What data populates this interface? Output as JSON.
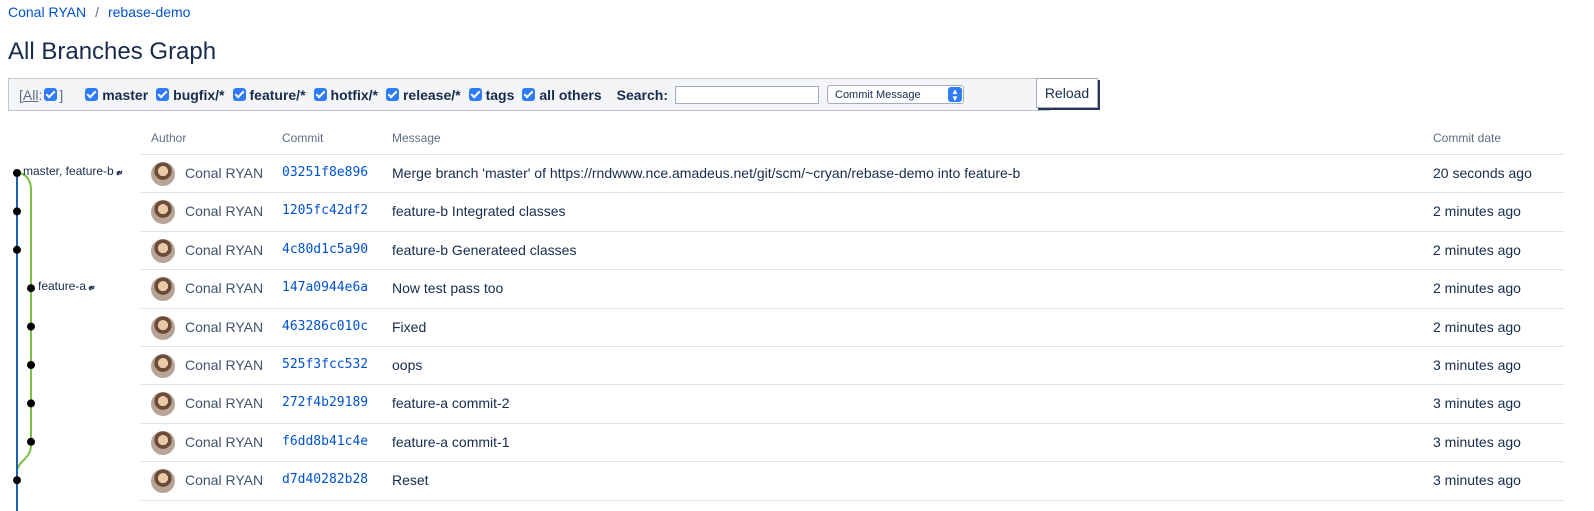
{
  "breadcrumb": {
    "owner": "Conal RYAN",
    "separator": "/",
    "repo": "rebase-demo"
  },
  "page_title": "All Branches Graph",
  "filters": {
    "all_label": "All",
    "all_open": "[",
    "all_colon": ":",
    "all_close": "]",
    "items": [
      {
        "label": "master",
        "checked": true
      },
      {
        "label": "bugfix/*",
        "checked": true
      },
      {
        "label": "feature/*",
        "checked": true
      },
      {
        "label": "hotfix/*",
        "checked": true
      },
      {
        "label": "release/*",
        "checked": true
      },
      {
        "label": "tags",
        "checked": true
      },
      {
        "label": "all others",
        "checked": true
      }
    ],
    "search_label": "Search:",
    "search_value": "",
    "search_type": "Commit Message",
    "reload_label": "Reload"
  },
  "table": {
    "headers": {
      "author": "Author",
      "commit": "Commit",
      "message": "Message",
      "date": "Commit date"
    },
    "rows": [
      {
        "author": "Conal RYAN",
        "commit": "03251f8e896",
        "message": "Merge branch 'master' of https://rndwww.nce.amadeus.net/git/scm/~cryan/rebase-demo into feature-b",
        "date": "20 seconds ago"
      },
      {
        "author": "Conal RYAN",
        "commit": "1205fc42df2",
        "message": "feature-b Integrated classes",
        "date": "2 minutes ago"
      },
      {
        "author": "Conal RYAN",
        "commit": "4c80d1c5a90",
        "message": "feature-b Generateed classes",
        "date": "2 minutes ago"
      },
      {
        "author": "Conal RYAN",
        "commit": "147a0944e6a",
        "message": "Now test pass too",
        "date": "2 minutes ago"
      },
      {
        "author": "Conal RYAN",
        "commit": "463286c010c",
        "message": "Fixed",
        "date": "2 minutes ago"
      },
      {
        "author": "Conal RYAN",
        "commit": "525f3fcc532",
        "message": "oops",
        "date": "3 minutes ago"
      },
      {
        "author": "Conal RYAN",
        "commit": "272f4b29189",
        "message": "feature-a commit-2",
        "date": "3 minutes ago"
      },
      {
        "author": "Conal RYAN",
        "commit": "f6dd8b41c4e",
        "message": "feature-a commit-1",
        "date": "3 minutes ago"
      },
      {
        "author": "Conal RYAN",
        "commit": "d7d40282b28",
        "message": "Reset",
        "date": "3 minutes ago"
      }
    ]
  },
  "graph": {
    "labels": [
      {
        "row": 0,
        "text": "master, feature-b",
        "icon": "tag-icon"
      },
      {
        "row": 3,
        "text": "feature-a",
        "icon": "tag-icon"
      }
    ],
    "colors": {
      "main_line": "#1f5fb0",
      "branch_line": "#7ac143",
      "node": "#000000"
    }
  }
}
